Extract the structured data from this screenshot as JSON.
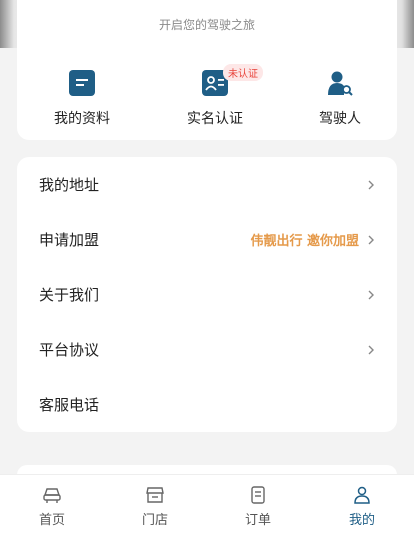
{
  "header": {
    "subtitle": "开启您的驾驶之旅"
  },
  "quick_actions": [
    {
      "label": "我的资料",
      "icon": "profile-card-icon"
    },
    {
      "label": "实名认证",
      "icon": "id-card-icon",
      "badge": "未认证"
    },
    {
      "label": "驾驶人",
      "icon": "driver-search-icon"
    }
  ],
  "menu": [
    {
      "label": "我的地址",
      "extra": ""
    },
    {
      "label": "申请加盟",
      "extra": "伟靓出行 邀你加盟"
    },
    {
      "label": "关于我们",
      "extra": ""
    },
    {
      "label": "平台协议",
      "extra": ""
    },
    {
      "label": "客服电话",
      "extra": ""
    }
  ],
  "tabbar": [
    {
      "label": "首页",
      "icon": "car-icon",
      "active": false
    },
    {
      "label": "门店",
      "icon": "store-icon",
      "active": false
    },
    {
      "label": "订单",
      "icon": "order-icon",
      "active": false
    },
    {
      "label": "我的",
      "icon": "user-icon",
      "active": true
    }
  ],
  "colors": {
    "accent": "#1f5e86",
    "badge_text": "#e8443c",
    "promo_text": "#e59a4b"
  }
}
